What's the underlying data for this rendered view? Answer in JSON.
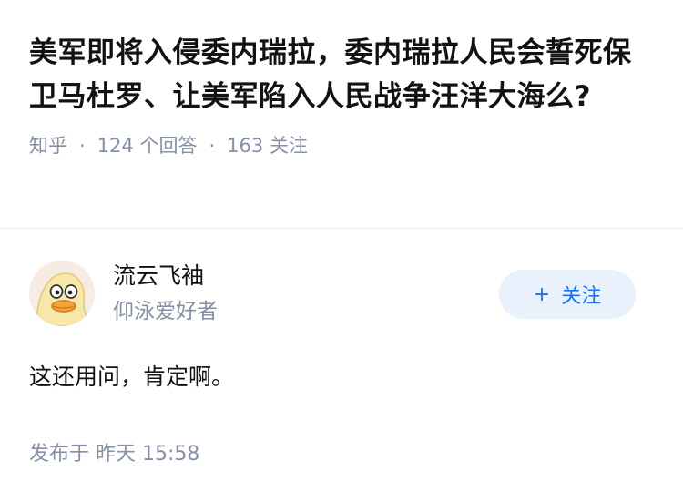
{
  "question": {
    "title": "美军即将入侵委内瑞拉，委内瑞拉人民会誓死保卫马杜罗、让美军陷入人民战争汪洋大海么?",
    "source": "知乎",
    "answer_count": "124",
    "answer_label": "个回答",
    "follower_count": "163",
    "follower_label": "关注",
    "separator": "·"
  },
  "answer": {
    "author": {
      "name": "流云飞袖",
      "bio": "仰泳爱好者",
      "avatar": "duck-avatar"
    },
    "follow_button": {
      "icon": "+",
      "label": "关注"
    },
    "content": "这还用问，肯定啊。",
    "published_label": "发布于",
    "published_time": "昨天 15:58"
  },
  "colors": {
    "text_primary": "#121212",
    "text_secondary": "#8590a6",
    "accent": "#1772f6",
    "follow_bg": "#e8f1fc",
    "divider": "#ebebeb"
  }
}
